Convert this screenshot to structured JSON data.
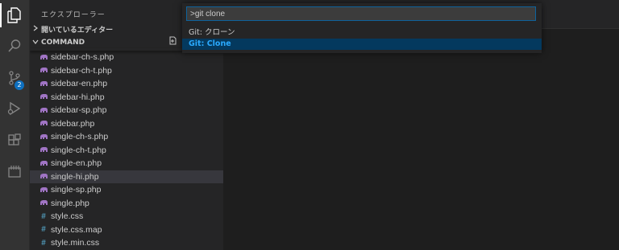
{
  "activity_bar": {
    "items": [
      {
        "icon": "files-icon"
      },
      {
        "icon": "search-icon"
      },
      {
        "icon": "source-control-icon",
        "badge": "2"
      },
      {
        "icon": "run-debug-icon"
      },
      {
        "icon": "extensions-icon"
      },
      {
        "icon": "remote-icon"
      }
    ]
  },
  "sidebar": {
    "title": "エクスプローラー",
    "open_editors_label": "開いているエディター",
    "folder_label": "COMMAND",
    "files": [
      {
        "name": "sidebar-ch-s.php",
        "type": "php"
      },
      {
        "name": "sidebar-ch-t.php",
        "type": "php"
      },
      {
        "name": "sidebar-en.php",
        "type": "php"
      },
      {
        "name": "sidebar-hi.php",
        "type": "php"
      },
      {
        "name": "sidebar-sp.php",
        "type": "php"
      },
      {
        "name": "sidebar.php",
        "type": "php"
      },
      {
        "name": "single-ch-s.php",
        "type": "php"
      },
      {
        "name": "single-ch-t.php",
        "type": "php"
      },
      {
        "name": "single-en.php",
        "type": "php"
      },
      {
        "name": "single-hi.php",
        "type": "php",
        "selected": true
      },
      {
        "name": "single-sp.php",
        "type": "php"
      },
      {
        "name": "single.php",
        "type": "php"
      },
      {
        "name": "style.css",
        "type": "css"
      },
      {
        "name": "style.css.map",
        "type": "css"
      },
      {
        "name": "style.min.css",
        "type": "css"
      }
    ]
  },
  "command_palette": {
    "input_value": ">git clone",
    "items": [
      {
        "prefix": "Git: ",
        "label": "クローン"
      },
      {
        "prefix": "Git: ",
        "label": "Clone"
      }
    ]
  },
  "colors": {
    "php_icon": "#a074c4",
    "css_icon": "#519aba",
    "highlight": "#2aaaff",
    "selection": "#04395e",
    "accent": "#0e639c"
  }
}
